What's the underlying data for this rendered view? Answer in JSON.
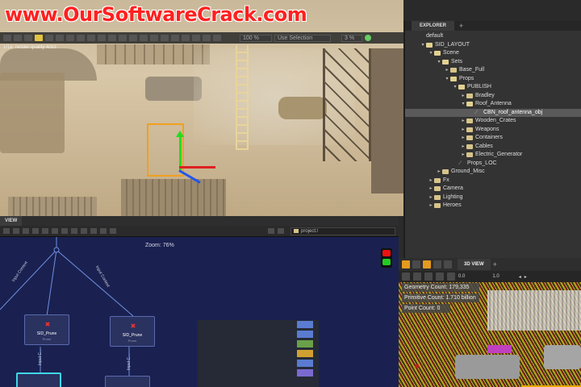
{
  "watermark": "www.OurSoftwareCrack.com",
  "viewport": {
    "info_text": "1/1e. render quality 4/3/1",
    "zoom": "100 %",
    "selection_mode": "Use Selection",
    "field_value": "3 %"
  },
  "explorer": {
    "tab_label": "EXPLORER",
    "add_tab": "+",
    "tree": [
      {
        "label": "default",
        "depth": 1,
        "arrow": "",
        "icon": "none",
        "selected": false
      },
      {
        "label": "SID_LAYOUT",
        "depth": 1,
        "arrow": "▾",
        "icon": "folder-open",
        "selected": false
      },
      {
        "label": "Scene",
        "depth": 2,
        "arrow": "▾",
        "icon": "folder-open",
        "selected": false
      },
      {
        "label": "Sets",
        "depth": 3,
        "arrow": "▾",
        "icon": "folder-open",
        "selected": false
      },
      {
        "label": "Base_Full",
        "depth": 4,
        "arrow": "▸",
        "icon": "folder",
        "selected": false
      },
      {
        "label": "Props",
        "depth": 4,
        "arrow": "▾",
        "icon": "folder-open",
        "selected": false
      },
      {
        "label": "PUBLISH",
        "depth": 5,
        "arrow": "▾",
        "icon": "folder-open",
        "selected": false
      },
      {
        "label": "Bradley",
        "depth": 6,
        "arrow": "▸",
        "icon": "folder",
        "selected": false
      },
      {
        "label": "Roof_Antenna",
        "depth": 6,
        "arrow": "▾",
        "icon": "folder-open",
        "selected": false
      },
      {
        "label": "CBN_roof_antenna_obj",
        "depth": 7,
        "arrow": "",
        "icon": "object",
        "selected": true
      },
      {
        "label": "Wooden_Crates",
        "depth": 6,
        "arrow": "▸",
        "icon": "folder",
        "selected": false
      },
      {
        "label": "Weapons",
        "depth": 6,
        "arrow": "▸",
        "icon": "folder",
        "selected": false
      },
      {
        "label": "Containers",
        "depth": 6,
        "arrow": "▸",
        "icon": "folder",
        "selected": false
      },
      {
        "label": "Cables",
        "depth": 6,
        "arrow": "▸",
        "icon": "folder",
        "selected": false
      },
      {
        "label": "Electric_Generator",
        "depth": 6,
        "arrow": "▸",
        "icon": "folder",
        "selected": false
      },
      {
        "label": "Props_LOC",
        "depth": 5,
        "arrow": "",
        "icon": "object",
        "selected": false
      },
      {
        "label": "Ground_Misc",
        "depth": 3,
        "arrow": "▸",
        "icon": "folder",
        "selected": false
      },
      {
        "label": "Fx",
        "depth": 2,
        "arrow": "▸",
        "icon": "folder",
        "selected": false
      },
      {
        "label": "Camera",
        "depth": 2,
        "arrow": "▸",
        "icon": "folder",
        "selected": false
      },
      {
        "label": "Lighting",
        "depth": 2,
        "arrow": "▸",
        "icon": "folder",
        "selected": false
      },
      {
        "label": "Heroes",
        "depth": 2,
        "arrow": "▸",
        "icon": "folder",
        "selected": false
      }
    ]
  },
  "nodegraph": {
    "tab_label": "VIEW",
    "path": "project:/",
    "zoom_label": "Zoom: 76%",
    "nodes": [
      {
        "label": "SID_Prune",
        "sub": "Prune"
      },
      {
        "label": "SID_Prune",
        "sub": "Prune"
      }
    ],
    "edge_labels": [
      "Input Context",
      "Input Context",
      "Input C...",
      "Input C..."
    ],
    "swatch_colors": [
      "#5a7bd0",
      "#5a7bd0",
      "#6aa04a",
      "#d0a030",
      "#5a7bd0",
      "#7a6ad0"
    ]
  },
  "view3d": {
    "tab_label": "3D VIEW",
    "add_tab": "+",
    "value1": "0.0",
    "value2": "1.0",
    "stats": [
      "Geometry Count: 179,335",
      "Primitive Count: 1.710 billion",
      "Point Count: 0"
    ]
  }
}
